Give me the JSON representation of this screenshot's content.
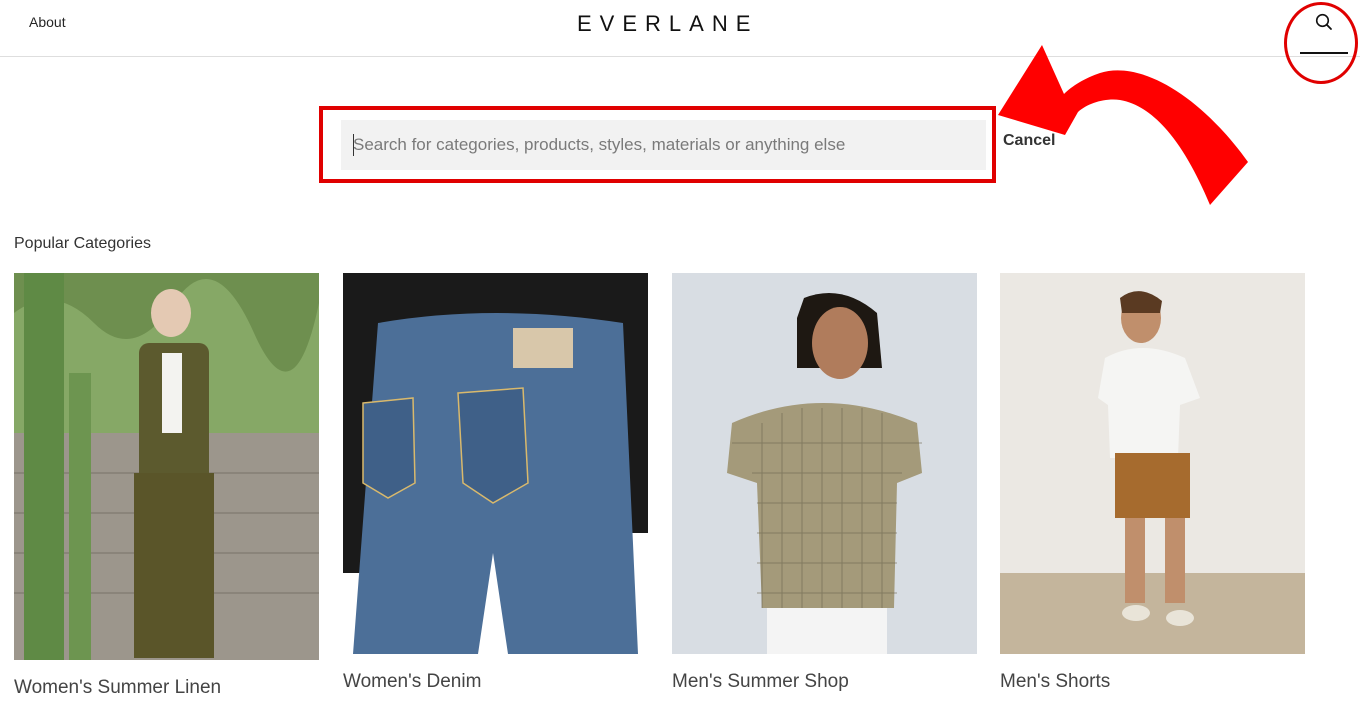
{
  "header": {
    "about_label": "About",
    "logo_text": "EVERLANE"
  },
  "search": {
    "placeholder": "Search for categories, products, styles, materials or anything else",
    "cancel_label": "Cancel"
  },
  "section": {
    "title": "Popular Categories"
  },
  "categories": [
    {
      "label": "Women's Summer Linen"
    },
    {
      "label": "Women's Denim"
    },
    {
      "label": "Men's Summer Shop"
    },
    {
      "label": "Men's Shorts"
    }
  ],
  "colors": {
    "annotation_red": "#e00000",
    "input_bg": "#f2f2f2",
    "text": "#262626"
  },
  "icons": {
    "search": "search-icon"
  }
}
